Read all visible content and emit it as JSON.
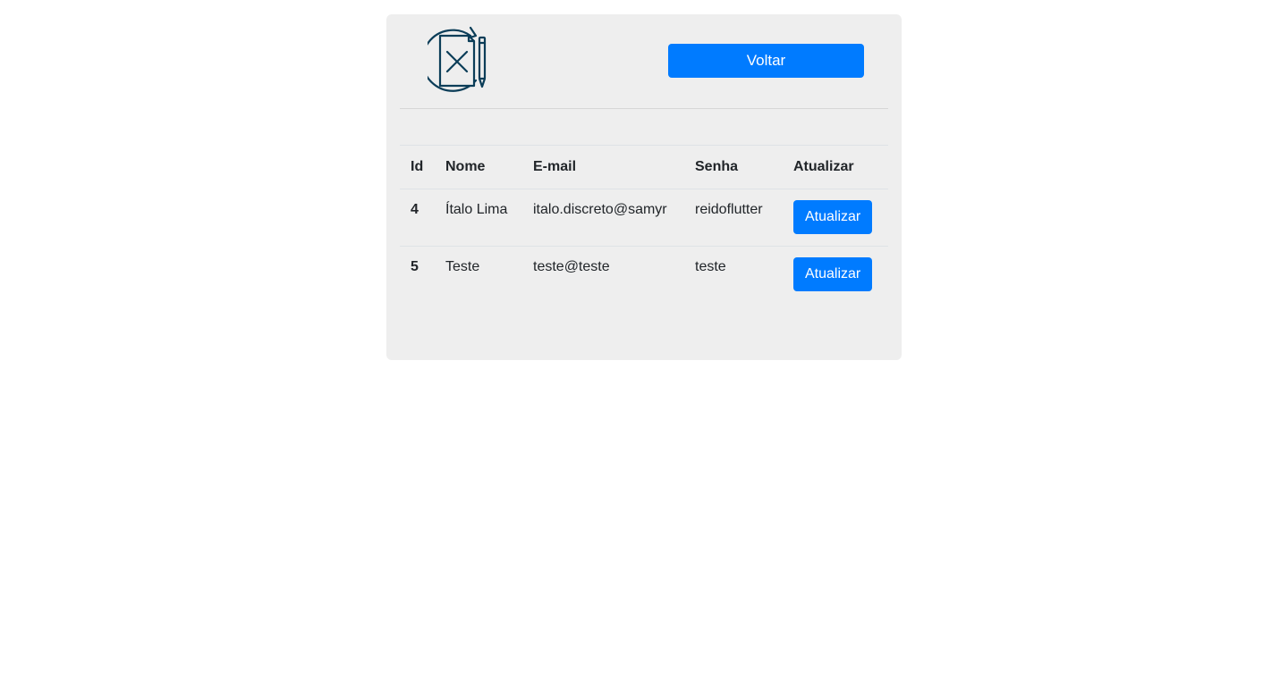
{
  "header": {
    "logo_icon": "document-edit-refresh-icon",
    "back_label": "Voltar"
  },
  "colors": {
    "primary": "#007bff",
    "card_background": "#eeeeee",
    "logo_stroke": "#0b3d58"
  },
  "table": {
    "columns": [
      "Id",
      "Nome",
      "E-mail",
      "Senha",
      "Atualizar"
    ],
    "rows": [
      {
        "id": "4",
        "nome": "Ítalo Lima",
        "email": "italo.discreto@samyr",
        "senha": "reidoflutter",
        "action_label": "Atualizar"
      },
      {
        "id": "5",
        "nome": "Teste",
        "email": "teste@teste",
        "senha": "teste",
        "action_label": "Atualizar"
      }
    ]
  }
}
